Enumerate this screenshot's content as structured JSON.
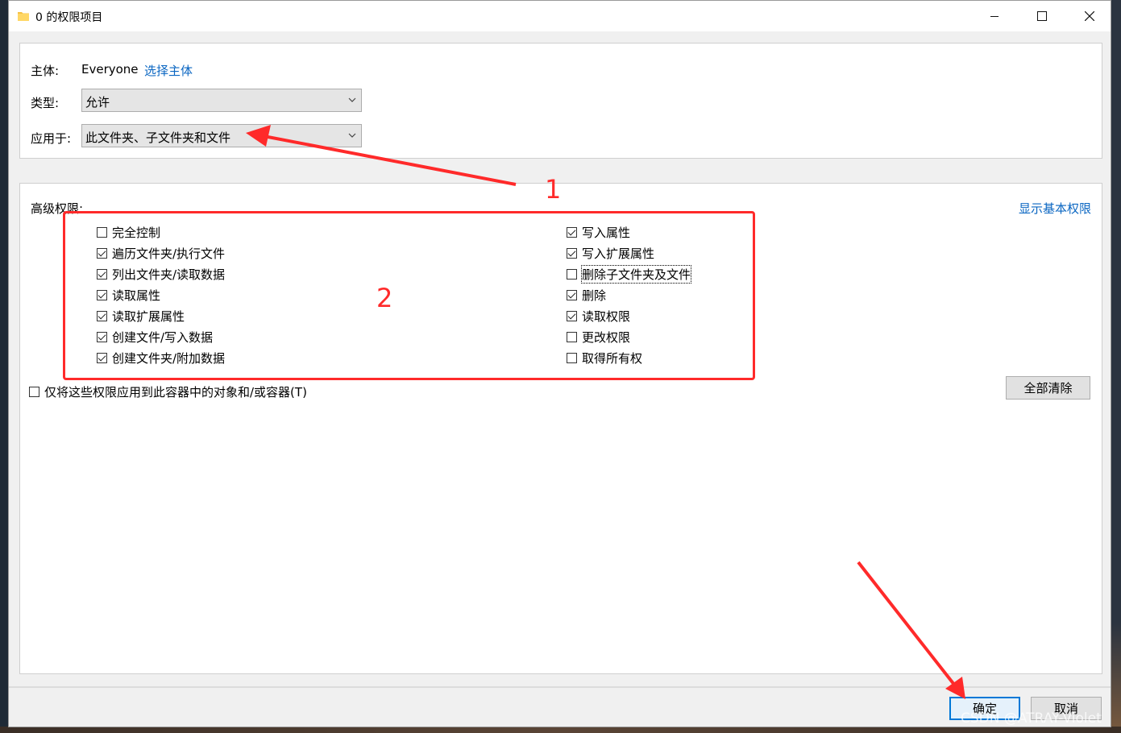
{
  "window": {
    "title": "0 的权限项目"
  },
  "principal": {
    "label": "主体:",
    "value": "Everyone",
    "select_link": "选择主体"
  },
  "type": {
    "label": "类型:",
    "value": "允许"
  },
  "applies_to": {
    "label": "应用于:",
    "value": "此文件夹、子文件夹和文件"
  },
  "advanced": {
    "heading": "高级权限:",
    "show_basic_link": "显示基本权限"
  },
  "permissions_left": [
    {
      "label": "完全控制",
      "checked": false
    },
    {
      "label": "遍历文件夹/执行文件",
      "checked": true
    },
    {
      "label": "列出文件夹/读取数据",
      "checked": true
    },
    {
      "label": "读取属性",
      "checked": true
    },
    {
      "label": "读取扩展属性",
      "checked": true
    },
    {
      "label": "创建文件/写入数据",
      "checked": true
    },
    {
      "label": "创建文件夹/附加数据",
      "checked": true
    }
  ],
  "permissions_right": [
    {
      "label": "写入属性",
      "checked": true
    },
    {
      "label": "写入扩展属性",
      "checked": true
    },
    {
      "label": "删除子文件夹及文件",
      "checked": false
    },
    {
      "label": "删除",
      "checked": true
    },
    {
      "label": "读取权限",
      "checked": true
    },
    {
      "label": "更改权限",
      "checked": false
    },
    {
      "label": "取得所有权",
      "checked": false
    }
  ],
  "apply_only": {
    "label": "仅将这些权限应用到此容器中的对象和/或容器(T)",
    "checked": false
  },
  "buttons": {
    "clear_all": "全部清除",
    "ok": "确定",
    "cancel": "取消"
  },
  "annotations": {
    "num1": "1",
    "num2": "2",
    "color": "#ff2a2a"
  },
  "watermark": "CSDN @ATRAY-Violet"
}
